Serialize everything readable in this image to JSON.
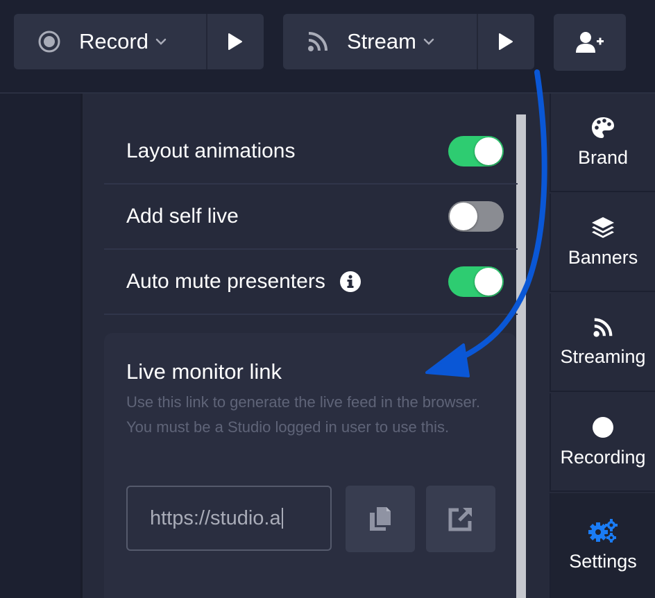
{
  "toolbar": {
    "record_label": "Record",
    "stream_label": "Stream"
  },
  "settings": {
    "rows": [
      {
        "label": "Layout animations",
        "enabled": true
      },
      {
        "label": "Add self live",
        "enabled": false
      },
      {
        "label": "Auto mute presenters",
        "enabled": true
      }
    ]
  },
  "live_monitor": {
    "title": "Live monitor link",
    "description": "Use this link to generate the live feed in the browser. You must be a Studio logged in user to use this.",
    "link_value": "https://studio.a"
  },
  "sidebar": {
    "items": [
      {
        "label": "Brand",
        "icon": "palette-icon"
      },
      {
        "label": "Banners",
        "icon": "layers-icon"
      },
      {
        "label": "Streaming",
        "icon": "rss-icon"
      },
      {
        "label": "Recording",
        "icon": "circle-icon"
      },
      {
        "label": "Settings",
        "icon": "cogs-icon",
        "active": true
      }
    ]
  },
  "colors": {
    "background": "#1c2030",
    "panel": "#262a3b",
    "toggle_on": "#2ecc71",
    "toggle_off": "#8a8c92",
    "accent_blue": "#1a7cf5",
    "annotation_arrow": "#0a57d6"
  }
}
